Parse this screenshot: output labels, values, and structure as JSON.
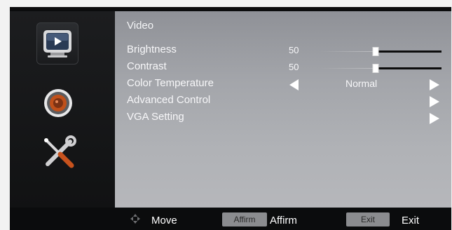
{
  "sidebar": {
    "items": [
      {
        "icon": "tv-video-icon",
        "selected": true
      },
      {
        "icon": "speaker-audio-icon",
        "selected": false
      },
      {
        "icon": "wrench-screwdriver-icon",
        "selected": false
      }
    ]
  },
  "panel": {
    "title": "Video",
    "rows": [
      {
        "label": "Brightness",
        "value": "50",
        "type": "slider",
        "level": 0.5
      },
      {
        "label": "Contrast",
        "value": "50",
        "type": "slider",
        "level": 0.5
      },
      {
        "label": "Color Temperature",
        "value": "Normal",
        "type": "selector"
      },
      {
        "label": "Advanced Control",
        "type": "submenu"
      },
      {
        "label": "VGA Setting",
        "type": "submenu"
      }
    ]
  },
  "footer": {
    "move_label": "Move",
    "affirm_button": "Affirm",
    "affirm_label": "Affirm",
    "exit_button": "Exit",
    "exit_label": "Exit"
  },
  "colors": {
    "panel_top": "#8f9197",
    "panel_bottom": "#b6b7bb",
    "text": "#f7f7f9",
    "button_bg": "#8b8c8f"
  }
}
